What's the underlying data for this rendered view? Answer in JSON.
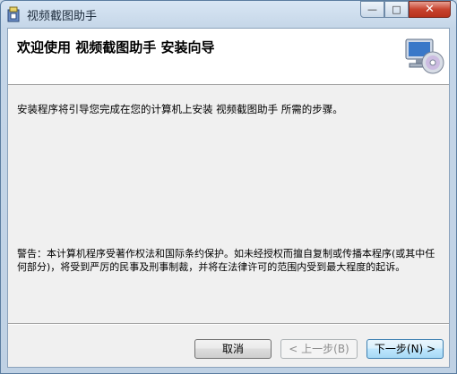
{
  "window": {
    "title": "视频截图助手",
    "controls": {
      "minimize": "—",
      "maximize": "□",
      "close": "✕"
    }
  },
  "banner": {
    "title": "欢迎使用 视频截图助手 安装向导",
    "art_icon": "computer-cd-icon"
  },
  "content": {
    "intro": "安装程序将引导您完成在您的计算机上安装 视频截图助手 所需的步骤。",
    "copyright_warning": "警告：本计算机程序受著作权法和国际条约保护。如未经授权而擅自复制或传播本程序(或其中任何部分)，将受到严厉的民事及刑事制裁，并将在法律许可的范围内受到最大程度的起诉。"
  },
  "buttons": {
    "cancel": "取消",
    "back": "< 上一步(B)",
    "next": "下一步(N) >"
  }
}
